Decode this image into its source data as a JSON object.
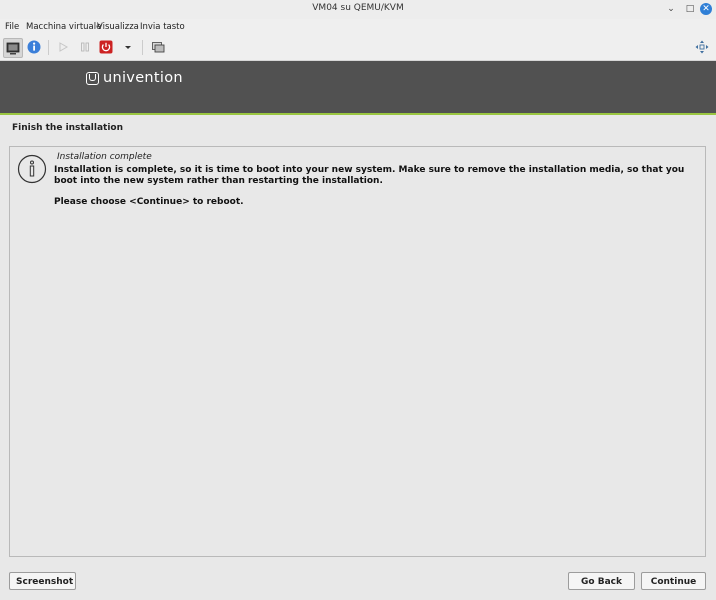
{
  "window": {
    "title": "VM04 su QEMU/KVM",
    "minimize_glyph": "⌄",
    "maximize_glyph": "□",
    "close_glyph": "✕"
  },
  "menubar": {
    "items": [
      "File",
      "Macchina virtuale",
      "Visualizza",
      "Invia tasto"
    ]
  },
  "toolbar": {
    "icons": [
      "display-console-icon",
      "details-info-icon",
      "run-icon",
      "pause-icon",
      "shutdown-icon",
      "shutdown-menu-arrow-icon",
      "snapshot-icon",
      "fullscreen-icon"
    ],
    "colors": {
      "info": "#3b7fd9",
      "shutdown": "#cc2222"
    }
  },
  "guest": {
    "brand": "univention",
    "colors": {
      "banner": "#515151",
      "accent": "#9ac640"
    },
    "page_title": "Finish the installation",
    "message": {
      "title": "Installation complete",
      "line1": "Installation is complete, so it is time to boot into your new system. Make sure to remove the installation media, so that you boot into the new system rather than restarting the installation.",
      "line2": "Please choose <Continue> to reboot."
    },
    "buttons": {
      "screenshot": "Screenshot",
      "back": "Go Back",
      "continue": "Continue"
    }
  }
}
